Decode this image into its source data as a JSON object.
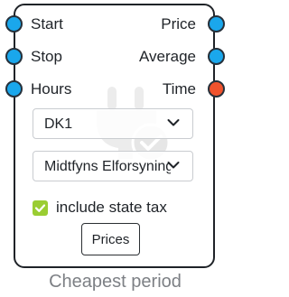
{
  "node": {
    "title": "Cheapest period",
    "inputs": [
      {
        "label": "Start",
        "color": "#1aa7ec"
      },
      {
        "label": "Stop",
        "color": "#1aa7ec"
      },
      {
        "label": "Hours",
        "color": "#1aa7ec"
      }
    ],
    "outputs": [
      {
        "label": "Price",
        "color": "#1aa7ec"
      },
      {
        "label": "Average",
        "color": "#1aa7ec"
      },
      {
        "label": "Time",
        "color": "#f0532d"
      }
    ],
    "area_select": {
      "value": "DK1"
    },
    "grid_select": {
      "value": "Midtfyns Elforsyning"
    },
    "tax_checkbox": {
      "label": "include state tax",
      "checked": true,
      "color": "#9acd32"
    },
    "prices_button": {
      "label": "Prices"
    },
    "watermark_icon": "plug-check-icon"
  }
}
